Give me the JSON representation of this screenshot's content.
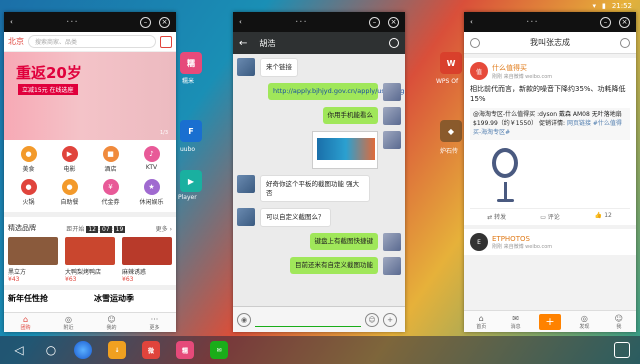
{
  "status": {
    "time": "21:52"
  },
  "desktop": {
    "icons": [
      {
        "label": "糯米",
        "color": "#e64a7a"
      },
      {
        "label": "uubo",
        "color": "#1a6fd0"
      },
      {
        "label": "Player",
        "color": "#1ab0a0"
      },
      {
        "label": "WPS Of",
        "color": "#d9402c"
      },
      {
        "label": "炉石传",
        "color": "#8a5a2c"
      }
    ]
  },
  "win1": {
    "city": "北京",
    "search_placeholder": "搜索商家、品类",
    "banner": {
      "title": "重返20岁",
      "sub": "立减15元 在线选座",
      "page": "1/3"
    },
    "categories": [
      {
        "label": "美食",
        "color": "#f39a2b",
        "icon": "food-icon",
        "glyph": "●"
      },
      {
        "label": "电影",
        "color": "#e0443c",
        "icon": "movie-icon",
        "glyph": "▶"
      },
      {
        "label": "酒店",
        "color": "#f08a3c",
        "icon": "hotel-icon",
        "glyph": "■"
      },
      {
        "label": "KTV",
        "color": "#e85a98",
        "icon": "mic-icon",
        "glyph": "♪"
      },
      {
        "label": "火锅",
        "color": "#e0443c",
        "icon": "hotpot-icon",
        "glyph": "●"
      },
      {
        "label": "自助餐",
        "color": "#f39a2b",
        "icon": "buffet-icon",
        "glyph": "●"
      },
      {
        "label": "代金券",
        "color": "#e85a98",
        "icon": "voucher-icon",
        "glyph": "¥"
      },
      {
        "label": "休闲娱乐",
        "color": "#a06ad0",
        "icon": "leisure-icon",
        "glyph": "★"
      }
    ],
    "brand": {
      "title": "精选品牌",
      "ends": "距开始",
      "h": "12",
      "m": "07",
      "s": "19",
      "more": "更多 ›"
    },
    "shops": [
      {
        "name": "黑立方",
        "price": "¥43"
      },
      {
        "name": "大鸭梨烤鸭店",
        "price": "¥63"
      },
      {
        "name": "麻辣诱惑",
        "price": "¥63"
      }
    ],
    "promos": [
      {
        "label": "新年任性抢",
        "color": "#222"
      },
      {
        "label": "冰雪运动季",
        "color": "#222"
      }
    ],
    "nav": [
      "团购",
      "附近",
      "我的",
      "更多"
    ]
  },
  "win2": {
    "contact": "胡浩",
    "messages": [
      {
        "side": "left",
        "text": "来个链接"
      },
      {
        "side": "right",
        "text": "http://apply.bjhjyd.gov.cn/apply/user/register.html"
      },
      {
        "side": "right",
        "text": "你用手机能看么"
      },
      {
        "side": "right",
        "text": "[image]"
      },
      {
        "side": "left",
        "text": "好奇你这个平板的截图功能 强大否"
      },
      {
        "side": "left",
        "text": "可以自定义截图么？"
      },
      {
        "side": "right",
        "text": "键盘上有截图快捷键"
      },
      {
        "side": "right",
        "text": "目前还米有自定义截图功能"
      }
    ]
  },
  "win3": {
    "title": "我叫张志成",
    "post": {
      "user": "什么值得买",
      "meta": "刚刚 来自微博 weibo.com",
      "text": "相比前代而言，新款的噪音下降约35%、功耗降低15%",
      "repost": "@海淘专区-什么值得买 :dyson 戴森 AM08 无叶落地扇 $199.99（约￥1550） 促销详情:",
      "link": "网页链接",
      "tag": "#什么值得买-海淘专区#",
      "actions": [
        "转发",
        "评论",
        "12"
      ]
    },
    "post2": {
      "user": "ETPHOTOS",
      "meta": "刚刚 来自微博 weibo.com"
    },
    "nav": [
      "首页",
      "消息",
      "+",
      "发现",
      "我"
    ]
  }
}
